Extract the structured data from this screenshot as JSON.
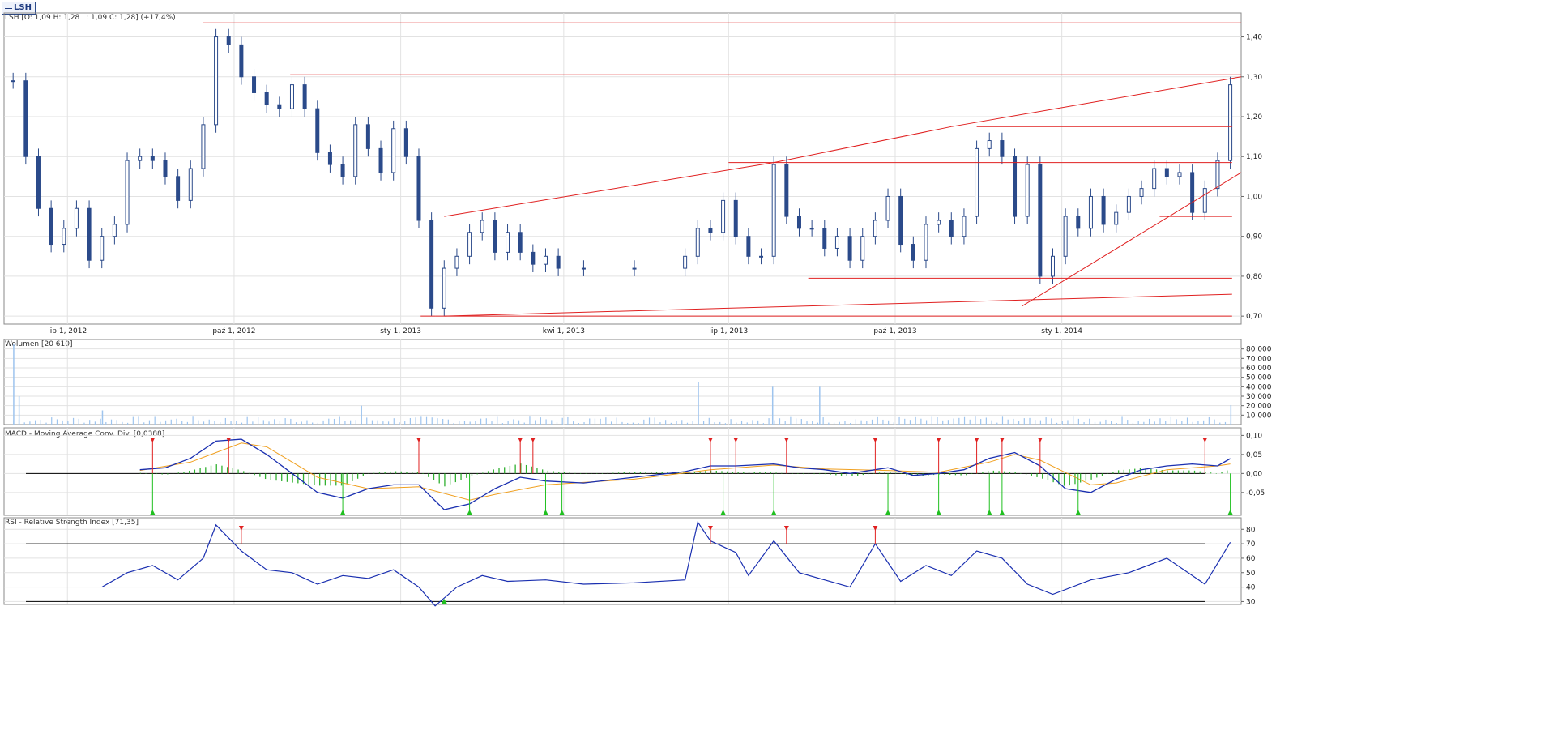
{
  "tab": {
    "label": "LSH"
  },
  "colors": {
    "candle": "#2b4a8a",
    "trendline": "#e02020",
    "volume": "#9ec4ee",
    "macd_hist": "#30b030",
    "signal": "#f0a020",
    "grid": "#e2e2e2"
  },
  "chart_data": [
    {
      "type": "candlestick",
      "title": "LSH [O: 1,09  H: 1,28  L: 1,09  C: 1,28] (+17,4%)",
      "ylim": [
        0.68,
        1.46
      ],
      "y_ticks": [
        "0,70",
        "0,80",
        "0,90",
        "1,00",
        "1,10",
        "1,20",
        "1,30",
        "1,40"
      ],
      "x_ticks": [
        "lip 1, 2012",
        "paź 1, 2012",
        "sty 1, 2013",
        "kwi 1, 2013",
        "lip 1, 2013",
        "paź 1, 2013",
        "sty 1, 2014"
      ],
      "x_tick_dates": [
        "2012-07-01",
        "2012-10-01",
        "2013-01-01",
        "2013-04-01",
        "2013-07-01",
        "2013-10-01",
        "2014-01-01"
      ],
      "x_range": [
        "2012-05-27",
        "2014-04-10"
      ],
      "close_path": [
        [
          "2012-06-01",
          1.29
        ],
        [
          "2012-06-08",
          1.1
        ],
        [
          "2012-06-15",
          0.97
        ],
        [
          "2012-06-22",
          0.88
        ],
        [
          "2012-06-29",
          0.92
        ],
        [
          "2012-07-06",
          0.97
        ],
        [
          "2012-07-13",
          0.84
        ],
        [
          "2012-07-20",
          0.9
        ],
        [
          "2012-07-27",
          0.93
        ],
        [
          "2012-08-03",
          1.09
        ],
        [
          "2012-08-10",
          1.1
        ],
        [
          "2012-08-17",
          1.09
        ],
        [
          "2012-08-24",
          1.05
        ],
        [
          "2012-08-31",
          0.99
        ],
        [
          "2012-09-07",
          1.07
        ],
        [
          "2012-09-14",
          1.18
        ],
        [
          "2012-09-21",
          1.4
        ],
        [
          "2012-09-28",
          1.38
        ],
        [
          "2012-10-05",
          1.3
        ],
        [
          "2012-10-12",
          1.26
        ],
        [
          "2012-10-19",
          1.23
        ],
        [
          "2012-10-26",
          1.22
        ],
        [
          "2012-11-02",
          1.28
        ],
        [
          "2012-11-09",
          1.22
        ],
        [
          "2012-11-16",
          1.11
        ],
        [
          "2012-11-23",
          1.08
        ],
        [
          "2012-11-30",
          1.05
        ],
        [
          "2012-12-07",
          1.18
        ],
        [
          "2012-12-14",
          1.12
        ],
        [
          "2012-12-21",
          1.06
        ],
        [
          "2012-12-28",
          1.17
        ],
        [
          "2013-01-04",
          1.1
        ],
        [
          "2013-01-11",
          0.94
        ],
        [
          "2013-01-18",
          0.72
        ],
        [
          "2013-01-25",
          0.82
        ],
        [
          "2013-02-01",
          0.85
        ],
        [
          "2013-02-08",
          0.91
        ],
        [
          "2013-02-15",
          0.94
        ],
        [
          "2013-02-22",
          0.86
        ],
        [
          "2013-03-01",
          0.91
        ],
        [
          "2013-03-08",
          0.86
        ],
        [
          "2013-03-15",
          0.83
        ],
        [
          "2013-03-22",
          0.85
        ],
        [
          "2013-03-29",
          0.82
        ],
        [
          "2013-04-12",
          0.82
        ],
        [
          "2013-05-10",
          0.82
        ],
        [
          "2013-06-07",
          0.85
        ],
        [
          "2013-06-14",
          0.92
        ],
        [
          "2013-06-21",
          0.91
        ],
        [
          "2013-06-28",
          0.99
        ],
        [
          "2013-07-05",
          0.9
        ],
        [
          "2013-07-12",
          0.85
        ],
        [
          "2013-07-19",
          0.85
        ],
        [
          "2013-07-26",
          1.08
        ],
        [
          "2013-08-02",
          0.95
        ],
        [
          "2013-08-09",
          0.92
        ],
        [
          "2013-08-16",
          0.92
        ],
        [
          "2013-08-23",
          0.87
        ],
        [
          "2013-08-30",
          0.9
        ],
        [
          "2013-09-06",
          0.84
        ],
        [
          "2013-09-13",
          0.9
        ],
        [
          "2013-09-20",
          0.94
        ],
        [
          "2013-09-27",
          1.0
        ],
        [
          "2013-10-04",
          0.88
        ],
        [
          "2013-10-11",
          0.84
        ],
        [
          "2013-10-18",
          0.93
        ],
        [
          "2013-10-25",
          0.94
        ],
        [
          "2013-11-01",
          0.9
        ],
        [
          "2013-11-08",
          0.95
        ],
        [
          "2013-11-15",
          1.12
        ],
        [
          "2013-11-22",
          1.14
        ],
        [
          "2013-11-29",
          1.1
        ],
        [
          "2013-12-06",
          0.95
        ],
        [
          "2013-12-13",
          1.08
        ],
        [
          "2013-12-20",
          0.8
        ],
        [
          "2013-12-27",
          0.85
        ],
        [
          "2014-01-03",
          0.95
        ],
        [
          "2014-01-10",
          0.92
        ],
        [
          "2014-01-17",
          1.0
        ],
        [
          "2014-01-24",
          0.93
        ],
        [
          "2014-01-31",
          0.96
        ],
        [
          "2014-02-07",
          1.0
        ],
        [
          "2014-02-14",
          1.02
        ],
        [
          "2014-02-21",
          1.07
        ],
        [
          "2014-02-28",
          1.05
        ],
        [
          "2014-03-07",
          1.06
        ],
        [
          "2014-03-14",
          0.96
        ],
        [
          "2014-03-21",
          1.02
        ],
        [
          "2014-03-28",
          1.09
        ],
        [
          "2014-04-04",
          1.28
        ]
      ]
    },
    {
      "type": "bar",
      "title": "Wolumen [20 610]",
      "ylim": [
        0,
        90000
      ],
      "y_ticks": [
        "10 000",
        "20 000",
        "30 000",
        "40 000",
        "50 000",
        "60 000",
        "70 000",
        "80 000"
      ],
      "spikes": [
        [
          "2012-06-01",
          85000
        ],
        [
          "2012-06-04",
          30000
        ],
        [
          "2012-07-20",
          15000
        ],
        [
          "2012-12-10",
          20000
        ],
        [
          "2013-06-14",
          45000
        ],
        [
          "2013-07-25",
          40000
        ],
        [
          "2013-08-20",
          40000
        ],
        [
          "2014-04-04",
          20610
        ]
      ]
    },
    {
      "type": "line",
      "title": "MACD - Moving Average Conv. Div. [0,0388]",
      "ylim": [
        -0.11,
        0.12
      ],
      "y_ticks": [
        "-0,05",
        "0,00",
        "0,05",
        "0,10"
      ],
      "macd": [
        [
          "2012-08-10",
          0.01
        ],
        [
          "2012-08-24",
          0.015
        ],
        [
          "2012-09-07",
          0.04
        ],
        [
          "2012-09-21",
          0.085
        ],
        [
          "2012-10-05",
          0.09
        ],
        [
          "2012-10-19",
          0.05
        ],
        [
          "2012-11-02",
          0.0
        ],
        [
          "2012-11-16",
          -0.05
        ],
        [
          "2012-11-30",
          -0.065
        ],
        [
          "2012-12-14",
          -0.04
        ],
        [
          "2012-12-28",
          -0.03
        ],
        [
          "2013-01-11",
          -0.03
        ],
        [
          "2013-01-25",
          -0.095
        ],
        [
          "2013-02-08",
          -0.08
        ],
        [
          "2013-02-22",
          -0.04
        ],
        [
          "2013-03-08",
          -0.01
        ],
        [
          "2013-03-22",
          -0.02
        ],
        [
          "2013-04-12",
          -0.025
        ],
        [
          "2013-05-10",
          -0.01
        ],
        [
          "2013-06-07",
          0.005
        ],
        [
          "2013-06-21",
          0.02
        ],
        [
          "2013-07-05",
          0.02
        ],
        [
          "2013-07-26",
          0.025
        ],
        [
          "2013-08-09",
          0.015
        ],
        [
          "2013-08-23",
          0.01
        ],
        [
          "2013-09-06",
          0.0
        ],
        [
          "2013-09-27",
          0.015
        ],
        [
          "2013-10-11",
          -0.005
        ],
        [
          "2013-10-25",
          0.0
        ],
        [
          "2013-11-08",
          0.01
        ],
        [
          "2013-11-22",
          0.04
        ],
        [
          "2013-12-06",
          0.055
        ],
        [
          "2013-12-20",
          0.02
        ],
        [
          "2014-01-03",
          -0.04
        ],
        [
          "2014-01-17",
          -0.05
        ],
        [
          "2014-01-31",
          -0.015
        ],
        [
          "2014-02-14",
          0.01
        ],
        [
          "2014-02-28",
          0.02
        ],
        [
          "2014-03-14",
          0.025
        ],
        [
          "2014-03-28",
          0.02
        ],
        [
          "2014-04-04",
          0.039
        ]
      ],
      "signal": [
        [
          "2012-08-10",
          0.008
        ],
        [
          "2012-09-07",
          0.03
        ],
        [
          "2012-10-05",
          0.08
        ],
        [
          "2012-10-19",
          0.07
        ],
        [
          "2012-11-16",
          -0.01
        ],
        [
          "2012-12-14",
          -0.04
        ],
        [
          "2013-01-11",
          -0.035
        ],
        [
          "2013-02-08",
          -0.07
        ],
        [
          "2013-02-22",
          -0.055
        ],
        [
          "2013-03-22",
          -0.03
        ],
        [
          "2013-05-10",
          -0.015
        ],
        [
          "2013-06-21",
          0.01
        ],
        [
          "2013-07-26",
          0.022
        ],
        [
          "2013-08-23",
          0.012
        ],
        [
          "2013-09-27",
          0.008
        ],
        [
          "2013-10-25",
          0.003
        ],
        [
          "2013-11-22",
          0.03
        ],
        [
          "2013-12-06",
          0.05
        ],
        [
          "2013-12-20",
          0.035
        ],
        [
          "2014-01-17",
          -0.03
        ],
        [
          "2014-01-31",
          -0.025
        ],
        [
          "2014-02-28",
          0.01
        ],
        [
          "2014-03-28",
          0.02
        ],
        [
          "2014-04-04",
          0.025
        ]
      ],
      "sell_signals": [
        "2012-08-17",
        "2012-09-28",
        "2013-01-11",
        "2013-03-08",
        "2013-03-15",
        "2013-06-21",
        "2013-07-05",
        "2013-08-02",
        "2013-09-20",
        "2013-10-25",
        "2013-11-15",
        "2013-11-29",
        "2013-12-20",
        "2014-03-21"
      ],
      "buy_signals": [
        "2012-08-17",
        "2012-11-30",
        "2013-02-08",
        "2013-03-22",
        "2013-03-31",
        "2013-06-28",
        "2013-07-26",
        "2013-09-27",
        "2013-10-25",
        "2013-11-22",
        "2013-11-29",
        "2014-01-10",
        "2014-04-04"
      ]
    },
    {
      "type": "line",
      "title": "RSI - Relative Strength Index [71,35]",
      "ylim": [
        28,
        88
      ],
      "y_ticks": [
        "30",
        "40",
        "50",
        "60",
        "70",
        "80"
      ],
      "overbought": 70,
      "oversold": 30,
      "rsi": [
        [
          "2012-07-20",
          40
        ],
        [
          "2012-08-03",
          50
        ],
        [
          "2012-08-17",
          55
        ],
        [
          "2012-08-31",
          45
        ],
        [
          "2012-09-14",
          60
        ],
        [
          "2012-09-21",
          83
        ],
        [
          "2012-10-05",
          65
        ],
        [
          "2012-10-19",
          52
        ],
        [
          "2012-11-02",
          50
        ],
        [
          "2012-11-16",
          42
        ],
        [
          "2012-11-30",
          48
        ],
        [
          "2012-12-14",
          46
        ],
        [
          "2012-12-28",
          52
        ],
        [
          "2013-01-11",
          40
        ],
        [
          "2013-01-20",
          27
        ],
        [
          "2013-02-01",
          40
        ],
        [
          "2013-02-15",
          48
        ],
        [
          "2013-03-01",
          44
        ],
        [
          "2013-03-22",
          45
        ],
        [
          "2013-04-12",
          42
        ],
        [
          "2013-05-10",
          43
        ],
        [
          "2013-06-07",
          45
        ],
        [
          "2013-06-14",
          85
        ],
        [
          "2013-06-21",
          72
        ],
        [
          "2013-07-05",
          64
        ],
        [
          "2013-07-12",
          48
        ],
        [
          "2013-07-26",
          72
        ],
        [
          "2013-08-09",
          50
        ],
        [
          "2013-08-23",
          45
        ],
        [
          "2013-09-06",
          40
        ],
        [
          "2013-09-20",
          70
        ],
        [
          "2013-10-04",
          44
        ],
        [
          "2013-10-18",
          55
        ],
        [
          "2013-11-01",
          48
        ],
        [
          "2013-11-15",
          65
        ],
        [
          "2013-11-29",
          60
        ],
        [
          "2013-12-13",
          42
        ],
        [
          "2013-12-27",
          35
        ],
        [
          "2014-01-17",
          45
        ],
        [
          "2014-02-07",
          50
        ],
        [
          "2014-02-28",
          60
        ],
        [
          "2014-03-21",
          42
        ],
        [
          "2014-04-04",
          71
        ]
      ],
      "sell_signals": [
        "2012-10-05",
        "2013-06-21",
        "2013-08-02",
        "2013-09-20"
      ],
      "buy_signals": [
        "2013-01-25"
      ]
    }
  ]
}
